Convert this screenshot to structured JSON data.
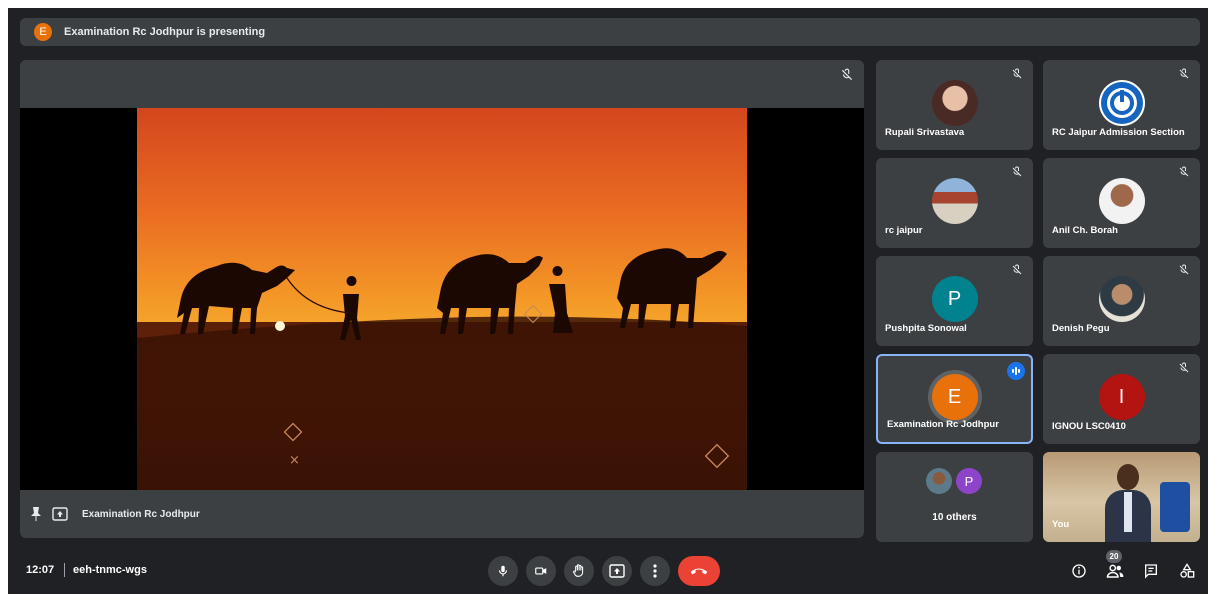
{
  "banner": {
    "avatar_letter": "E",
    "text": "Examination Rc Jodhpur is presenting"
  },
  "presentation": {
    "presenter_name": "Examination Rc Jodhpur"
  },
  "participants": [
    {
      "name": "Rupali Srivastava",
      "avatar": "photo",
      "muted": true
    },
    {
      "name": "RC Jaipur Admission Section",
      "avatar": "logo",
      "muted": true
    },
    {
      "name": "rc jaipur",
      "avatar": "photo",
      "muted": true
    },
    {
      "name": "Anil Ch. Borah",
      "avatar": "photo",
      "muted": true
    },
    {
      "name": "Pushpita Sonowal",
      "avatar_letter": "P",
      "avatar_color": "#00838f",
      "muted": true
    },
    {
      "name": "Denish Pegu",
      "avatar": "photo",
      "muted": true
    },
    {
      "name": "Examination Rc Jodhpur",
      "avatar_letter": "E",
      "avatar_color": "#e8710a",
      "speaking": true
    },
    {
      "name": "IGNOU LSC0410",
      "avatar_letter": "I",
      "avatar_color": "#b31412",
      "muted": true
    }
  ],
  "others": {
    "label": "10 others",
    "letter": "P",
    "color": "#8e44c9"
  },
  "self": {
    "label": "You"
  },
  "bottom": {
    "time": "12:07",
    "meeting_code": "eeh-tnmc-wgs",
    "people_count": "20"
  },
  "colors": {
    "bg": "#202124",
    "tile": "#3c4043",
    "end_call": "#ea4335",
    "active_border": "#8ab4f8"
  }
}
